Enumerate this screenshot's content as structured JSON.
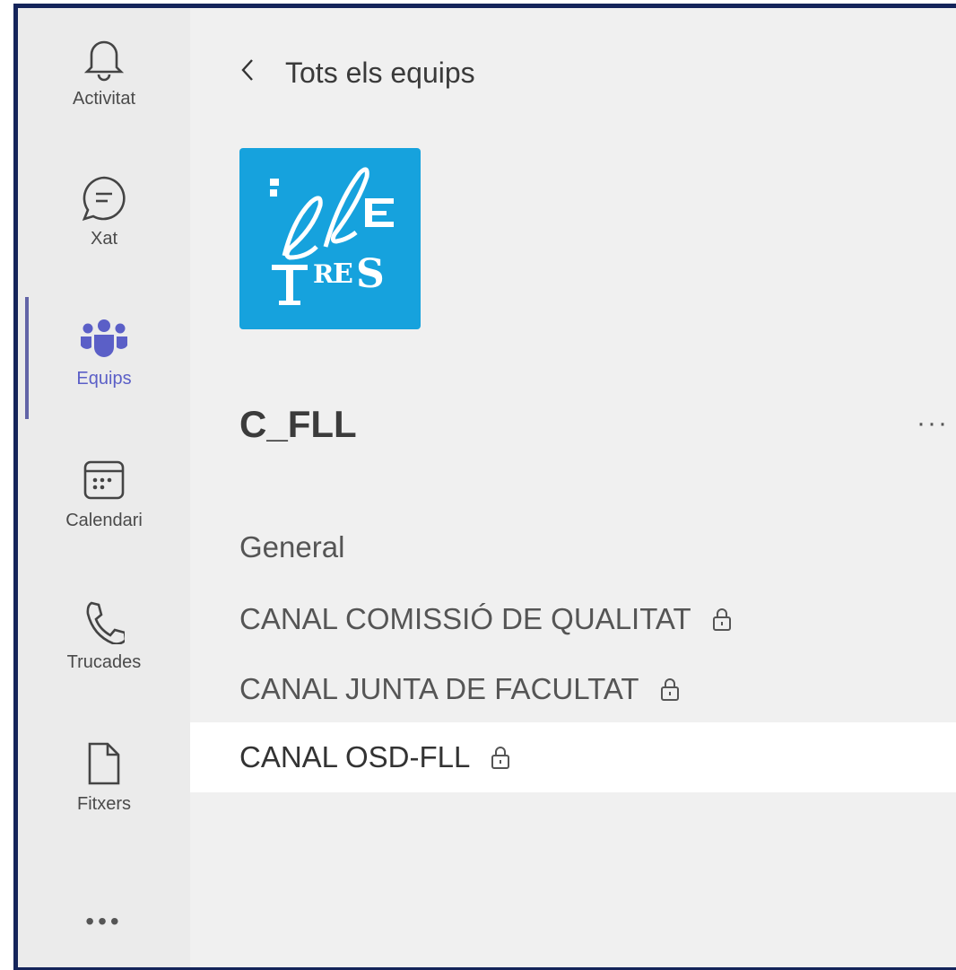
{
  "rail": {
    "items": [
      {
        "label": "Activitat",
        "icon": "bell-icon"
      },
      {
        "label": "Xat",
        "icon": "chat-icon"
      },
      {
        "label": "Equips",
        "icon": "teams-icon",
        "active": true
      },
      {
        "label": "Calendari",
        "icon": "calendar-icon"
      },
      {
        "label": "Trucades",
        "icon": "phone-icon"
      },
      {
        "label": "Fitxers",
        "icon": "file-icon"
      }
    ],
    "more": "•••",
    "accent_color": "#6264a7"
  },
  "nav": {
    "back_label": "Tots els equips",
    "back_icon": "chevron-left-icon"
  },
  "team": {
    "name": "C_FLL",
    "more": "···",
    "logo": {
      "color": "#16a2dd",
      "text_top": "ELE",
      "text_bottom": "TRES"
    }
  },
  "channels": [
    {
      "label": "General",
      "private": false
    },
    {
      "label": "CANAL COMISSIÓ DE QUALITAT",
      "private": true
    },
    {
      "label": "CANAL JUNTA DE FACULTAT",
      "private": true
    },
    {
      "label": "CANAL OSD-FLL",
      "private": true,
      "selected": true
    }
  ]
}
